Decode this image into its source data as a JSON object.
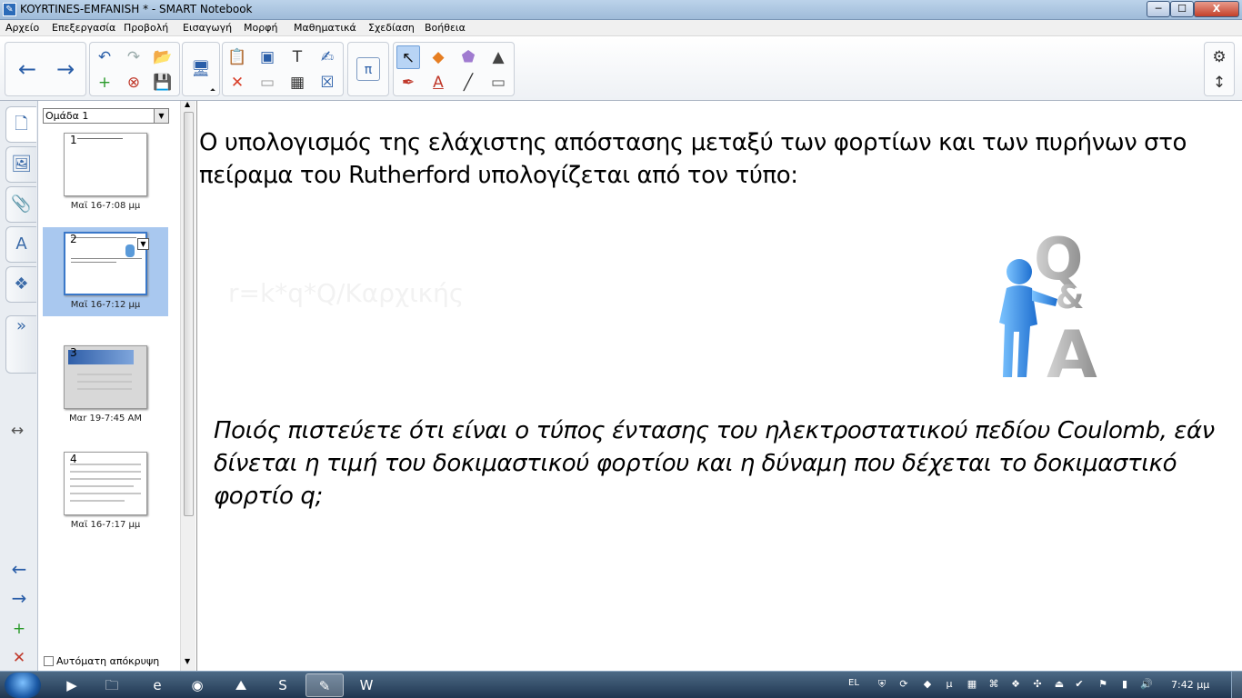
{
  "window": {
    "title": "KOYRTINES-EMFANISH * - SMART Notebook",
    "minimize": "─",
    "maximize": "☐",
    "close": "X"
  },
  "menu": [
    "Αρχείο",
    "Επεξεργασία",
    "Προβολή",
    "Εισαγωγή",
    "Μορφή",
    "Μαθηματικά",
    "Σχεδίαση",
    "Βοήθεια"
  ],
  "toolbar": {
    "back": "←",
    "forward": "→",
    "undo": "↶",
    "redo": "↷",
    "open": "📂",
    "add_page": "+",
    "delete_page": "⊗",
    "save": "💾",
    "screen": "🖥",
    "paste": "📋",
    "screen_shade": "▣",
    "text_tool": "T",
    "recognize": "✍",
    "delete": "✕",
    "table": "▦",
    "full_screen": "☒",
    "math": "π",
    "select": "↖",
    "shapes": "◆",
    "eraser_magic": "⬟",
    "fill": "▲",
    "pens": "✒",
    "text": "A",
    "line": "╱",
    "eraser": "▭",
    "settings": "⚙",
    "move_toolbar": "↕"
  },
  "sidetabs": {
    "page_sorter": "🗋",
    "gallery": "🖼",
    "attachments": "📎",
    "properties": "A",
    "addons": "❖",
    "expand": "»",
    "resize": "↔",
    "prev_page": "←",
    "next_page": "→",
    "add_page": "+",
    "delete_page": "✕"
  },
  "sorter": {
    "group": "Ομάδα 1",
    "pages": [
      {
        "number": "1",
        "date": "Μαϊ 16-7:08 μμ"
      },
      {
        "number": "2",
        "date": "Μαϊ 16-7:12 μμ"
      },
      {
        "number": "3",
        "date": "Μαr 19-7:45 AM"
      },
      {
        "number": "4",
        "date": "Μαϊ 16-7:17 μμ"
      }
    ],
    "autohide": "Αυτόματη απόκρυψη"
  },
  "page": {
    "heading": "Ο υπολογισμός της ελάχιστης απόστασης μεταξύ των φορτίων και των πυρήνων στο πείραμα του Rutherford υπολογίζεται από τον τύπο:",
    "formula": "r=k*q*Q/Καρχικής",
    "question": "Ποιός πιστεύετε ότι είναι ο τύπος έντασης του ηλεκτροστατικού πεδίου Coulomb, εάν δίνεται η τιμή του δοκιμαστικού φορτίου και η δύναμη που δέχεται το δοκιμαστικό φορτίο q;",
    "figure_letters": {
      "q": "Q",
      "amp": "&",
      "a": "A"
    }
  },
  "taskbar": {
    "language": "EL",
    "time": "7:42 μμ"
  }
}
